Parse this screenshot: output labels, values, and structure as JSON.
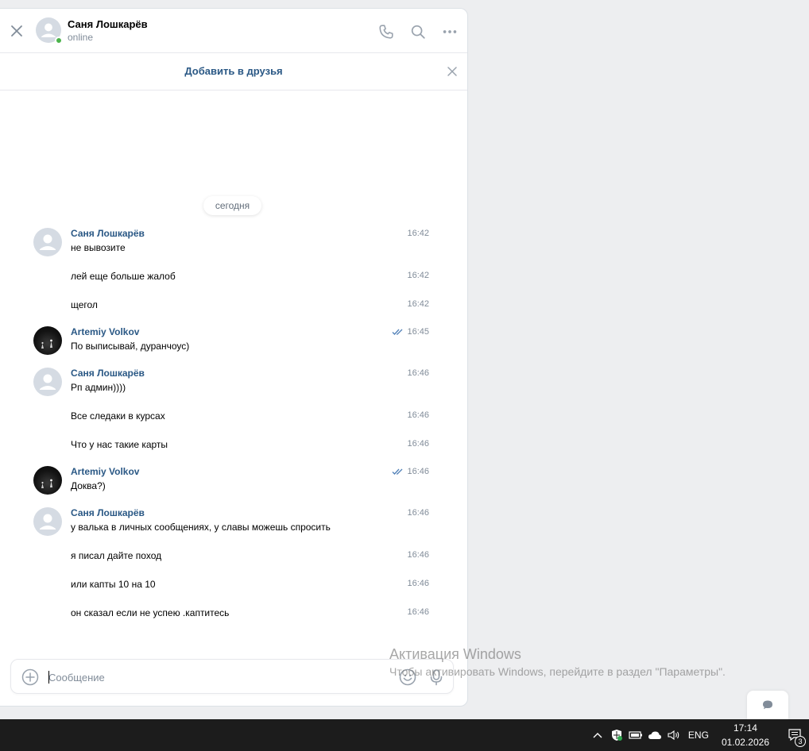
{
  "header": {
    "name": "Саня Лошкарёв",
    "status": "online"
  },
  "add_friend": {
    "label": "Добавить в друзья"
  },
  "date_divider": "сегодня",
  "messages": [
    {
      "author": "Саня Лошкарёв",
      "avatar": "default",
      "text": "не вывозите",
      "time": "16:42"
    },
    {
      "text": "лей еще больше жалоб",
      "time": "16:42"
    },
    {
      "text": "щегол",
      "time": "16:42"
    },
    {
      "author": "Artemiy Volkov",
      "avatar": "photo",
      "text": "По выписывай, дуранчоус)",
      "time": "16:45",
      "read": true
    },
    {
      "author": "Саня Лошкарёв",
      "avatar": "default",
      "text": "Рп админ))))",
      "time": "16:46"
    },
    {
      "text": "Все следаки в курсах",
      "time": "16:46"
    },
    {
      "text": "Что у нас такие карты",
      "time": "16:46"
    },
    {
      "author": "Artemiy Volkov",
      "avatar": "photo",
      "text": "Доква?)",
      "time": "16:46",
      "read": true
    },
    {
      "author": "Саня Лошкарёв",
      "avatar": "default",
      "text": "у валька в личных сообщениях, у славы можешь спросить",
      "time": "16:46"
    },
    {
      "text": "я писал дайте поход",
      "time": "16:46"
    },
    {
      "text": "или капты 10 на 10",
      "time": "16:46"
    },
    {
      "text": "он сказал если не успею .каптитесь",
      "time": "16:46"
    }
  ],
  "composer": {
    "placeholder": "Сообщение"
  },
  "watermark": {
    "title": "Активация Windows",
    "text": "Чтобы активировать Windows, перейдите в раздел \"Параметры\"."
  },
  "taskbar": {
    "language": "ENG",
    "time": "17:14",
    "date": "01.02.2026",
    "notification_count": "3"
  },
  "colors": {
    "link": "#2a5885",
    "secondary_text": "#818c99",
    "online": "#4bb34b",
    "page_bg": "#edeef0",
    "read_check": "#5181b8"
  }
}
